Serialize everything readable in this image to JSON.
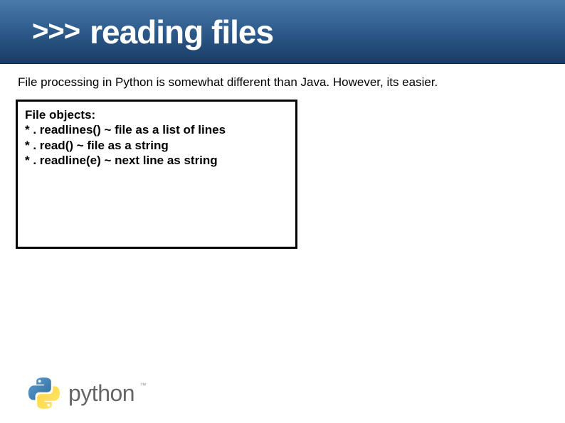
{
  "header": {
    "prompt": ">>>",
    "title": "reading files"
  },
  "subheading": "File processing in Python is somewhat different than Java.  However, its easier.",
  "box": {
    "heading": "File objects:",
    "lines": [
      "* . readlines() ~ file as a list of lines",
      "* . read() ~ file as a string",
      "* . readline(e) ~ next line as string"
    ]
  },
  "footer": {
    "logo_text": "python",
    "tm": "™"
  }
}
